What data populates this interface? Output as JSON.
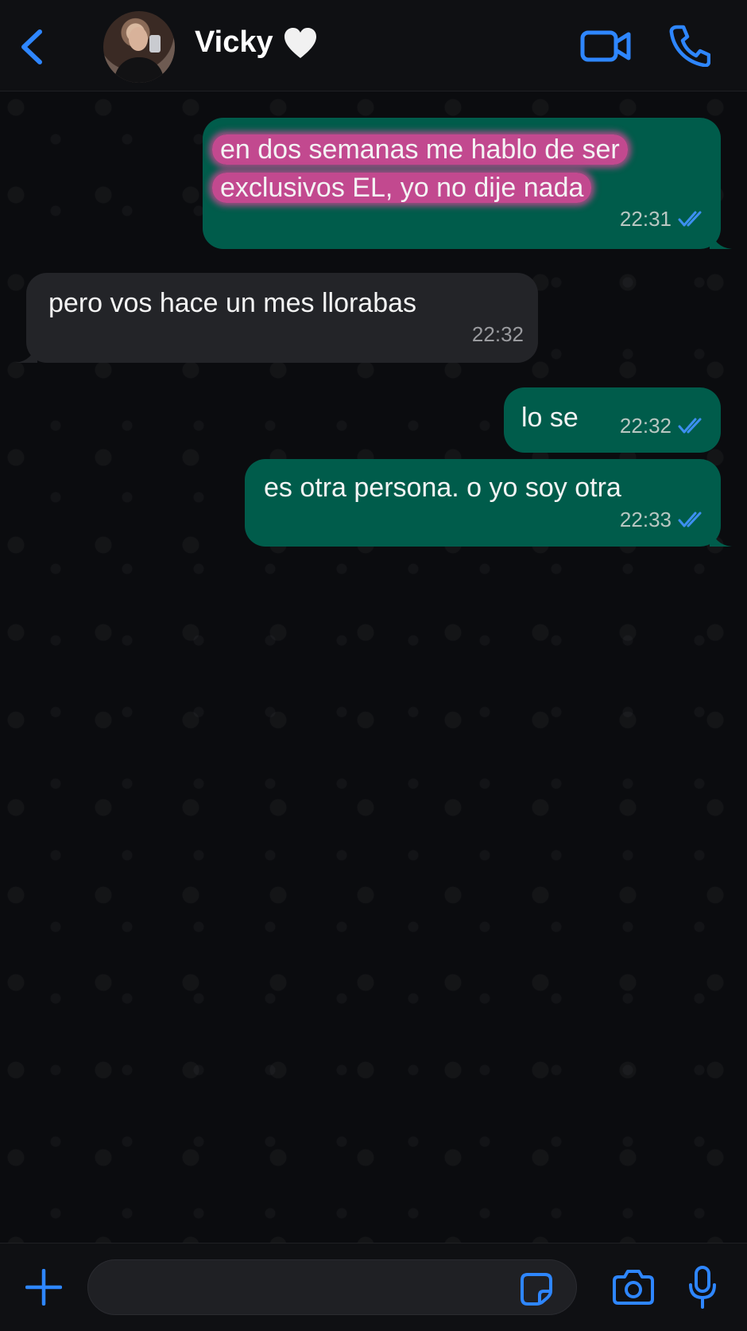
{
  "header": {
    "contact_name": "Vicky",
    "contact_emoji": "🤍",
    "icons": [
      "chevron-left-icon",
      "avatar",
      "video-camera-icon",
      "phone-icon"
    ],
    "accent_color": "#2e86ff"
  },
  "messages": [
    {
      "direction": "outgoing",
      "lines": [
        "en dos semanas me hablo de ser",
        "exclusivos EL, yo no dije nada"
      ],
      "time": "22:31",
      "status": "read",
      "highlighted": true
    },
    {
      "direction": "incoming",
      "lines": [
        "pero vos hace un mes llorabas"
      ],
      "time": "22:32"
    },
    {
      "direction": "outgoing",
      "lines": [
        "lo se"
      ],
      "time": "22:32",
      "status": "read"
    },
    {
      "direction": "outgoing",
      "lines": [
        "es otra persona. o yo soy otra"
      ],
      "time": "22:33",
      "status": "read"
    }
  ],
  "composer": {
    "value": "",
    "icons": [
      "plus-icon",
      "sticker-icon",
      "camera-icon",
      "microphone-icon"
    ]
  },
  "colors": {
    "outgoing_bubble": "#005c4b",
    "incoming_bubble": "#232428",
    "highlight": "#c2498f",
    "read_ticks": "#3d8ff0"
  }
}
